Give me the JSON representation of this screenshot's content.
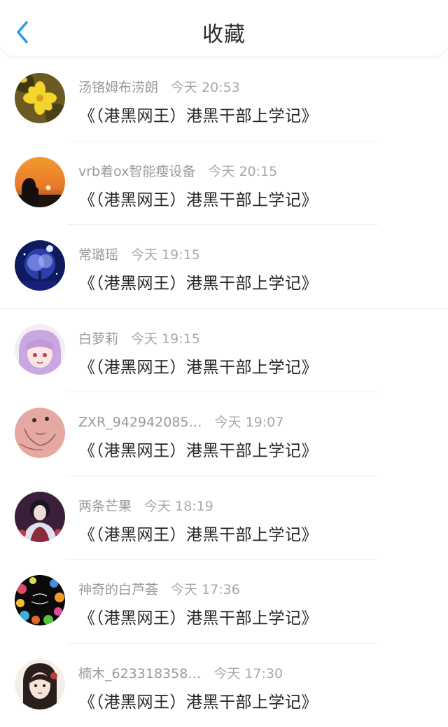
{
  "header": {
    "title": "收藏",
    "back_icon": "chevron-left-icon",
    "accent_color": "#2e9be6"
  },
  "items": [
    {
      "name": "汤铬姆布涝朗",
      "time": "今天 20:53",
      "message": "《（港黑网王）港黑干部上学记》"
    },
    {
      "name": "vrb着ox智能瘦设备",
      "time": "今天 20:15",
      "message": "《（港黑网王）港黑干部上学记》"
    },
    {
      "name": "常璐瑶",
      "time": "今天 19:15",
      "message": "《（港黑网王）港黑干部上学记》"
    },
    {
      "name": "白萝莉",
      "time": "今天 19:15",
      "message": "《（港黑网王）港黑干部上学记》"
    },
    {
      "name": "ZXR_942942085…",
      "time": "今天 19:07",
      "message": "《（港黑网王）港黑干部上学记》"
    },
    {
      "name": "两条芒果",
      "time": "今天 18:19",
      "message": "《（港黑网王）港黑干部上学记》"
    },
    {
      "name": "神奇的白芦荟",
      "time": "今天 17:36",
      "message": "《（港黑网王）港黑干部上学记》"
    },
    {
      "name": "楠木_623318358…",
      "time": "今天 17:30",
      "message": "《（港黑网王）港黑干部上学记》"
    }
  ]
}
